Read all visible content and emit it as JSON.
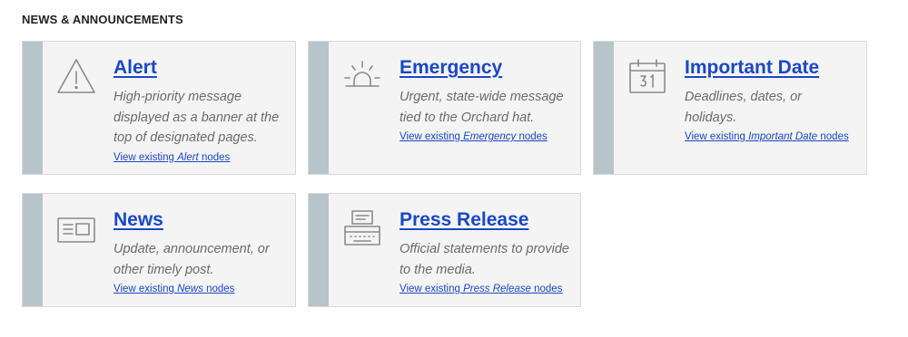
{
  "section": {
    "title": "NEWS & ANNOUNCEMENTS"
  },
  "colors": {
    "link": "#1a48c6",
    "accent_bar": "#b7c4c9",
    "card_bg": "#f4f4f4",
    "description": "#6b6b6b"
  },
  "cards": [
    {
      "icon": "warning-triangle-icon",
      "title": "Alert",
      "description": "High-priority message displayed as a banner at the top of designated pages.",
      "link_prefix": "View existing ",
      "link_type": "Alert",
      "link_suffix": " nodes"
    },
    {
      "icon": "siren-icon",
      "title": "Emergency",
      "description": "Urgent, state-wide message tied to the Orchard hat.",
      "link_prefix": "View existing ",
      "link_type": "Emergency",
      "link_suffix": " nodes"
    },
    {
      "icon": "calendar-icon",
      "title": "Important Date",
      "description": "Deadlines, dates, or holidays.",
      "link_prefix": "View existing ",
      "link_type": "Important Date",
      "link_suffix": " nodes"
    },
    {
      "icon": "newspaper-icon",
      "title": "News",
      "description": "Update, announcement, or other timely post.",
      "link_prefix": "View existing ",
      "link_type": "News",
      "link_suffix": " nodes"
    },
    {
      "icon": "typewriter-icon",
      "title": "Press Release",
      "description": "Official statements to provide to the media.",
      "link_prefix": "View existing ",
      "link_type": "Press Release",
      "link_suffix": " nodes"
    }
  ]
}
